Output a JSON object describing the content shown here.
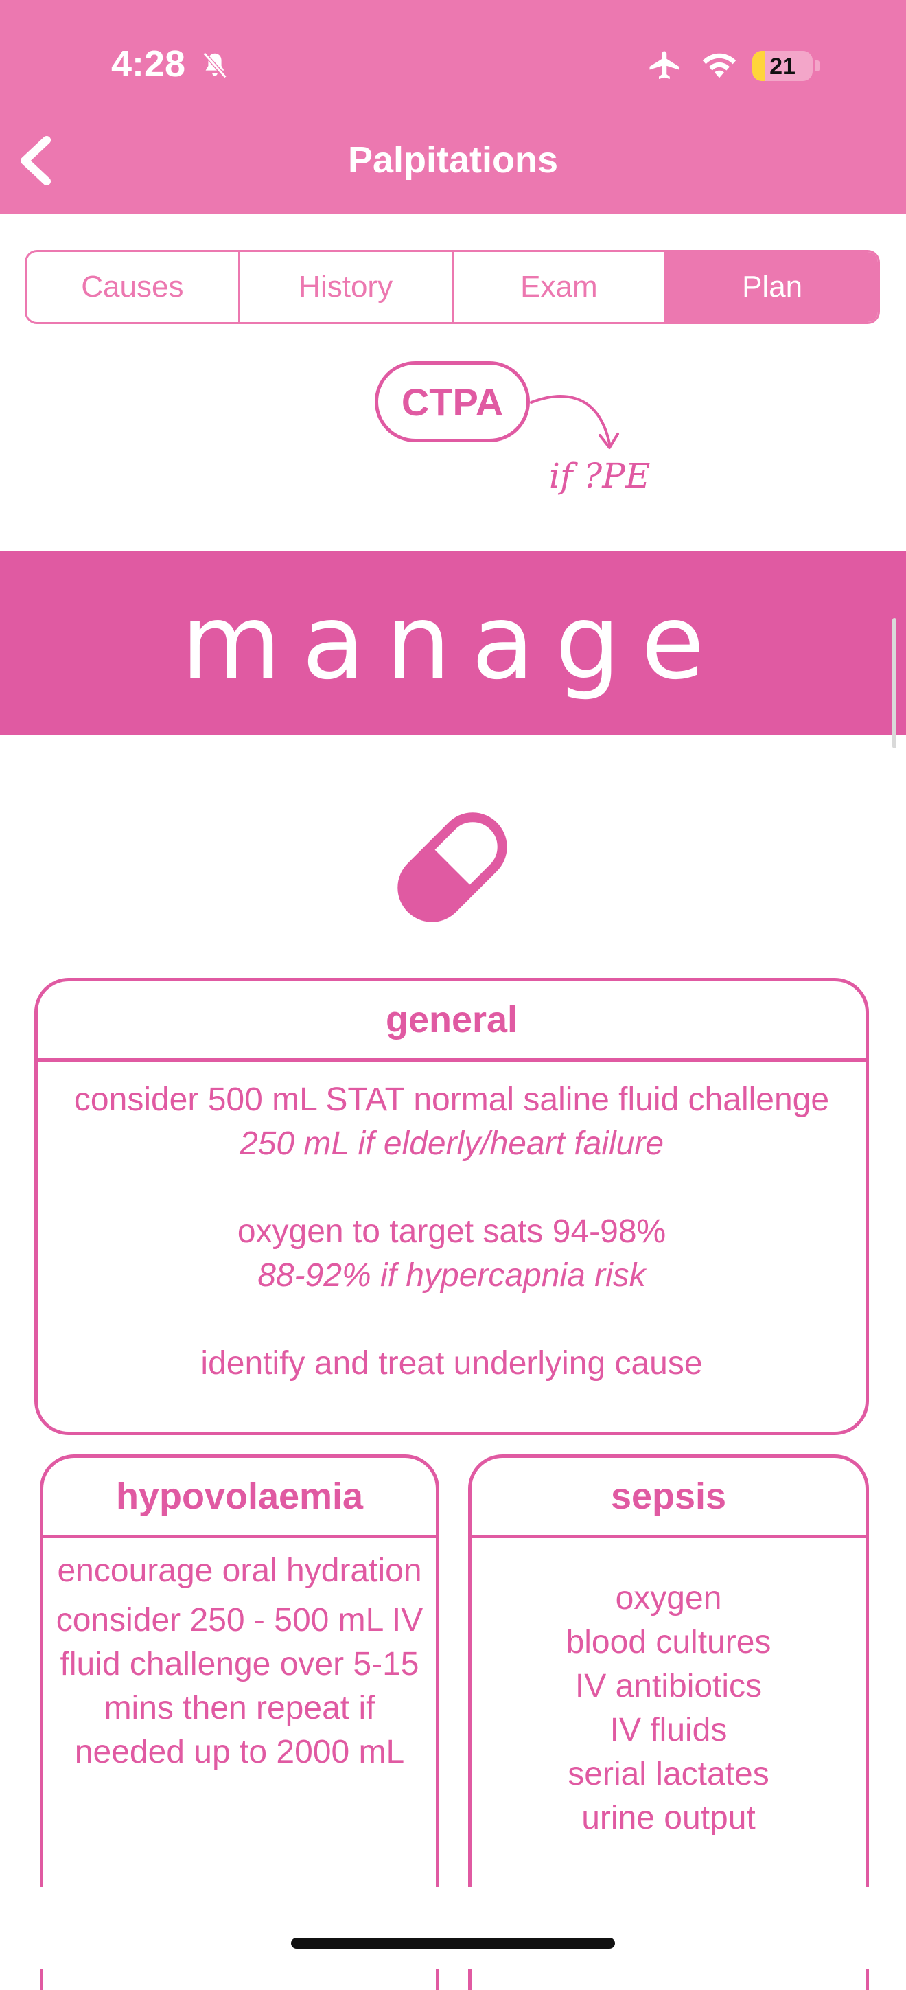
{
  "status_bar": {
    "time": "4:28",
    "battery": "21",
    "icons": [
      "bell-slash-icon",
      "airplane-icon",
      "wifi-icon",
      "battery-icon"
    ]
  },
  "nav": {
    "title": "Palpitations",
    "back_icon": "chevron-left-icon"
  },
  "tabs": [
    {
      "label": "Causes",
      "active": false
    },
    {
      "label": "History",
      "active": false
    },
    {
      "label": "Exam",
      "active": false
    },
    {
      "label": "Plan",
      "active": true
    }
  ],
  "investigation": {
    "pill_label": "CTPA",
    "annotation": "if ?PE"
  },
  "banner": {
    "title": "manage"
  },
  "icon": "capsule-icon",
  "general": {
    "title": "general",
    "line1": "consider 500 mL STAT normal saline fluid challenge",
    "line1_note": "250 mL if elderly/heart failure",
    "line2": "oxygen to target sats 94-98%",
    "line2_note": "88-92% if hypercapnia risk",
    "line3": "identify and treat underlying cause"
  },
  "hypovolaemia": {
    "title": "hypovolaemia",
    "p1": "encourage oral hydration",
    "p2": "consider 250 - 500 mL IV fluid challenge over 5-15 mins then repeat if needed up to 2000 mL"
  },
  "sepsis": {
    "title": "sepsis",
    "items": [
      "oxygen",
      "blood cultures",
      "IV antibiotics",
      "IV fluids",
      "serial lactates",
      "urine output"
    ]
  },
  "colors": {
    "header": "#ec78b0",
    "accent": "#e05aa2",
    "background": "#ffffff"
  }
}
